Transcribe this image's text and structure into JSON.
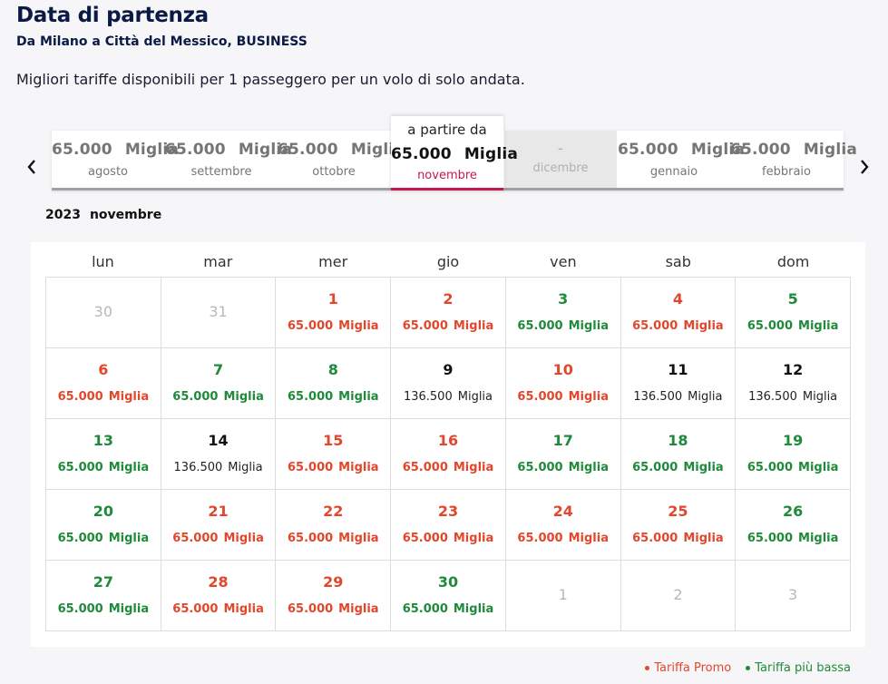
{
  "header": {
    "title": "Data di partenza",
    "subtitle": "Da Milano a Città del Messico, BUSINESS",
    "description": "Migliori tariffe disponibili per 1 passeggero per un volo di solo andata."
  },
  "month_strip": {
    "prev_icon": "chevron-left-icon",
    "next_icon": "chevron-right-icon",
    "active_prefix": "a partire da",
    "tabs": [
      {
        "price": "65.000",
        "unit": "Miglia",
        "month": "agosto",
        "state": "normal"
      },
      {
        "price": "65.000",
        "unit": "Miglia",
        "month": "settembre",
        "state": "normal"
      },
      {
        "price": "65.000",
        "unit": "Miglia",
        "month": "ottobre",
        "state": "normal"
      },
      {
        "price": "65.000",
        "unit": "Miglia",
        "month": "novembre",
        "state": "active"
      },
      {
        "price": "-",
        "unit": "",
        "month": "dicembre",
        "state": "disabled"
      },
      {
        "price": "65.000",
        "unit": "Miglia",
        "month": "gennaio",
        "state": "normal"
      },
      {
        "price": "65.000",
        "unit": "Miglia",
        "month": "febbraio",
        "state": "normal"
      }
    ]
  },
  "calendar": {
    "year": "2023",
    "month": "novembre",
    "weekdays": [
      "lun",
      "mar",
      "mer",
      "gio",
      "ven",
      "sab",
      "dom"
    ],
    "unit": "Miglia",
    "days": [
      {
        "day": "30",
        "type": "other",
        "price": ""
      },
      {
        "day": "31",
        "type": "other",
        "price": ""
      },
      {
        "day": "1",
        "type": "promo",
        "price": "65.000"
      },
      {
        "day": "2",
        "type": "promo",
        "price": "65.000"
      },
      {
        "day": "3",
        "type": "lowest",
        "price": "65.000"
      },
      {
        "day": "4",
        "type": "promo",
        "price": "65.000"
      },
      {
        "day": "5",
        "type": "lowest",
        "price": "65.000"
      },
      {
        "day": "6",
        "type": "promo",
        "price": "65.000"
      },
      {
        "day": "7",
        "type": "lowest",
        "price": "65.000"
      },
      {
        "day": "8",
        "type": "lowest",
        "price": "65.000"
      },
      {
        "day": "9",
        "type": "normal",
        "price": "136.500"
      },
      {
        "day": "10",
        "type": "promo",
        "price": "65.000"
      },
      {
        "day": "11",
        "type": "normal",
        "price": "136.500"
      },
      {
        "day": "12",
        "type": "normal",
        "price": "136.500"
      },
      {
        "day": "13",
        "type": "lowest",
        "price": "65.000"
      },
      {
        "day": "14",
        "type": "normal",
        "price": "136.500"
      },
      {
        "day": "15",
        "type": "promo",
        "price": "65.000"
      },
      {
        "day": "16",
        "type": "promo",
        "price": "65.000"
      },
      {
        "day": "17",
        "type": "lowest",
        "price": "65.000"
      },
      {
        "day": "18",
        "type": "lowest",
        "price": "65.000"
      },
      {
        "day": "19",
        "type": "lowest",
        "price": "65.000"
      },
      {
        "day": "20",
        "type": "lowest",
        "price": "65.000"
      },
      {
        "day": "21",
        "type": "promo",
        "price": "65.000"
      },
      {
        "day": "22",
        "type": "promo",
        "price": "65.000"
      },
      {
        "day": "23",
        "type": "promo",
        "price": "65.000"
      },
      {
        "day": "24",
        "type": "promo",
        "price": "65.000"
      },
      {
        "day": "25",
        "type": "promo",
        "price": "65.000"
      },
      {
        "day": "26",
        "type": "lowest",
        "price": "65.000"
      },
      {
        "day": "27",
        "type": "lowest",
        "price": "65.000"
      },
      {
        "day": "28",
        "type": "promo",
        "price": "65.000"
      },
      {
        "day": "29",
        "type": "promo",
        "price": "65.000"
      },
      {
        "day": "30",
        "type": "lowest",
        "price": "65.000"
      },
      {
        "day": "1",
        "type": "other",
        "price": ""
      },
      {
        "day": "2",
        "type": "other",
        "price": ""
      },
      {
        "day": "3",
        "type": "other",
        "price": ""
      }
    ]
  },
  "legend": {
    "promo_label": "Tariffa Promo",
    "lowest_label": "Tariffa più bassa"
  },
  "colors": {
    "promo": "#e2472b",
    "lowest": "#1f8a3a",
    "active_accent": "#c8174c",
    "title": "#0b1a45"
  }
}
